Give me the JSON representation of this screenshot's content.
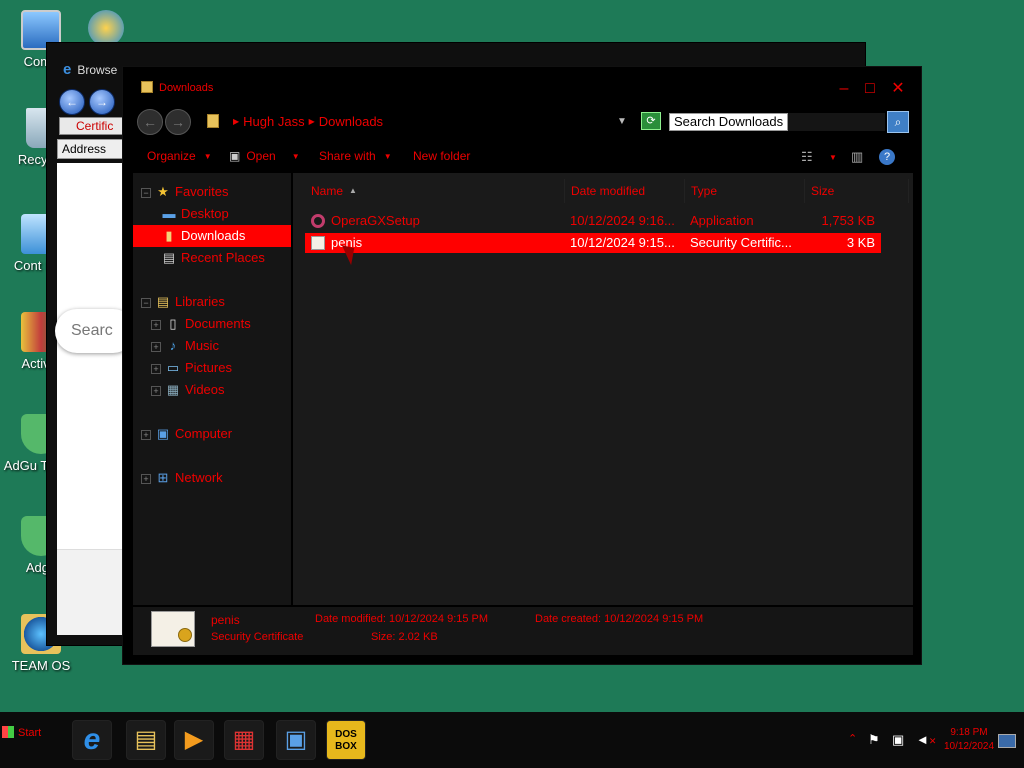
{
  "desktop": {
    "icons": [
      {
        "label": "Comp",
        "icon": "computer-icon"
      },
      {
        "label": "Recycle",
        "icon": "recycle-bin-icon"
      },
      {
        "label": "Cont Pan",
        "icon": "control-panel-icon"
      },
      {
        "label": "Activat",
        "icon": "activator-icon"
      },
      {
        "label": "AdGu Trial R",
        "icon": "adguard-icon"
      },
      {
        "label": "Adgu",
        "icon": "adguard-icon"
      },
      {
        "label": "TEAM OS",
        "icon": "team-os-icon"
      }
    ]
  },
  "browser": {
    "title": "Browse",
    "tab_label": "Certific",
    "address_label": "Address",
    "search_placeholder": "Searc"
  },
  "explorer": {
    "title": "Downloads",
    "breadcrumb": [
      "Hugh Jass",
      "Downloads"
    ],
    "search_placeholder": "Search Downloads",
    "toolbar": {
      "organize": "Organize",
      "open": "Open",
      "share_with": "Share with",
      "new_folder": "New folder"
    },
    "nav": {
      "favorites": "Favorites",
      "desktop": "Desktop",
      "downloads": "Downloads",
      "recent_places": "Recent Places",
      "libraries": "Libraries",
      "documents": "Documents",
      "music": "Music",
      "pictures": "Pictures",
      "videos": "Videos",
      "computer": "Computer",
      "network": "Network"
    },
    "columns": {
      "name": "Name",
      "date_modified": "Date modified",
      "type": "Type",
      "size": "Size"
    },
    "files": [
      {
        "name": "OperaGXSetup",
        "date": "10/12/2024 9:16...",
        "type": "Application",
        "size": "1,753 KB",
        "icon": "opera-gx-icon",
        "selected": false
      },
      {
        "name": "penis",
        "date": "10/12/2024 9:15...",
        "type": "Security Certific...",
        "size": "3 KB",
        "icon": "certificate-icon",
        "selected": true
      }
    ],
    "details": {
      "name": "penis",
      "type": "Security Certificate",
      "date_modified": "Date modified: 10/12/2024 9:15 PM",
      "size": "Size: 2.02 KB",
      "date_created": "Date created: 10/12/2024 9:15 PM"
    }
  },
  "taskbar": {
    "start_label": "Start",
    "apps": [
      {
        "name": "internet-explorer-icon",
        "glyph": "e"
      },
      {
        "name": "file-explorer-icon",
        "glyph": "▤"
      },
      {
        "name": "media-player-icon",
        "glyph": "▶"
      },
      {
        "name": "toolbox-icon",
        "glyph": "▦"
      },
      {
        "name": "network-settings-icon",
        "glyph": "▣"
      },
      {
        "name": "dosbox-icon",
        "glyph": "DOS BOX"
      }
    ],
    "clock_time": "9:18 PM",
    "clock_date": "10/12/2024"
  }
}
